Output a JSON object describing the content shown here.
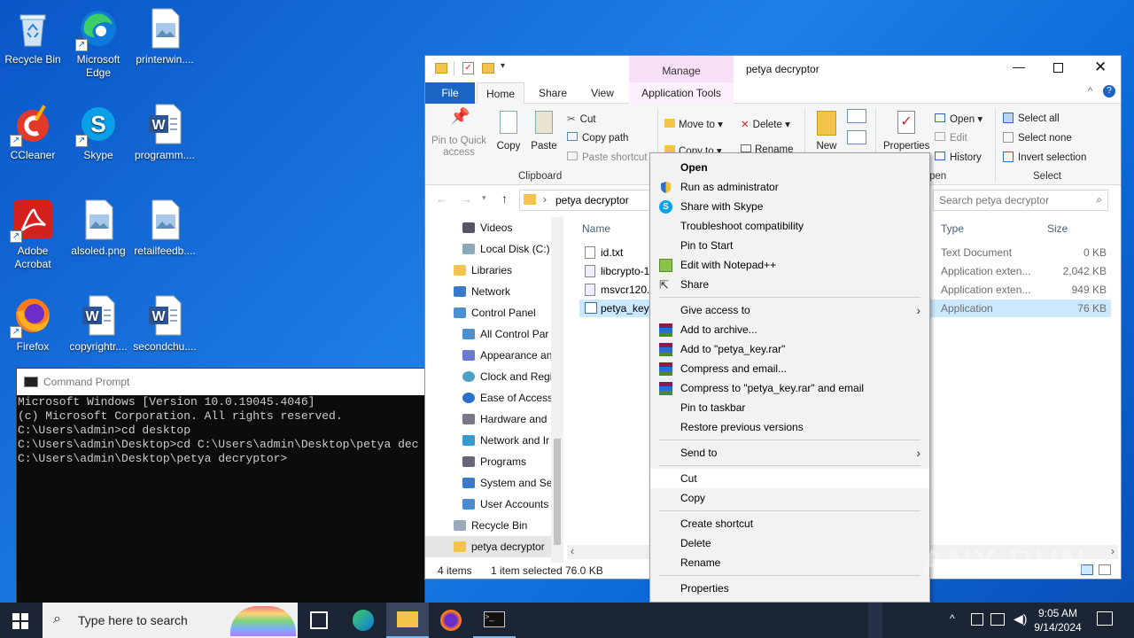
{
  "desktop": {
    "icons": [
      {
        "label": "Recycle Bin",
        "icon": "recycle-bin-icon"
      },
      {
        "label": "Microsoft Edge",
        "icon": "edge-icon"
      },
      {
        "label": "printerwin....",
        "icon": "image-file-icon"
      },
      {
        "label": "CCleaner",
        "icon": "ccleaner-icon"
      },
      {
        "label": "Skype",
        "icon": "skype-icon"
      },
      {
        "label": "programm....",
        "icon": "word-doc-icon"
      },
      {
        "label": "Adobe Acrobat",
        "icon": "acrobat-icon"
      },
      {
        "label": "alsoled.png",
        "icon": "image-file-icon"
      },
      {
        "label": "retailfeedb....",
        "icon": "image-file-icon"
      },
      {
        "label": "Firefox",
        "icon": "firefox-icon"
      },
      {
        "label": "copyrightr....",
        "icon": "word-doc-icon"
      },
      {
        "label": "secondchu....",
        "icon": "word-doc-icon"
      }
    ]
  },
  "explorer": {
    "title": "petya decryptor",
    "manage_label": "Manage",
    "tabs": [
      "File",
      "Home",
      "Share",
      "View",
      "Application Tools"
    ],
    "ribbon": {
      "pin_label": "Pin to Quick access",
      "copy": "Copy",
      "paste": "Paste",
      "cut": "Cut",
      "copy_path": "Copy path",
      "paste_shortcut": "Paste shortcut",
      "clipboard_group": "Clipboard",
      "move_to": "Move to",
      "delete": "Delete",
      "copy_to": "Copy to",
      "rename": "Rename",
      "new": "New",
      "properties": "Properties",
      "open": "Open",
      "edit": "Edit",
      "history": "History",
      "open_group": "pen",
      "select_all": "Select all",
      "select_none": "Select none",
      "invert_selection": "Invert selection",
      "select_group": "Select"
    },
    "address": {
      "crumb": "petya decryptor",
      "search_placeholder": "Search petya decryptor"
    },
    "nav_items": [
      "Videos",
      "Local Disk (C:)",
      "Libraries",
      "Network",
      "Control Panel",
      "All Control Par",
      "Appearance an",
      "Clock and Regi",
      "Ease of Access",
      "Hardware and",
      "Network and Ir",
      "Programs",
      "System and Se",
      "User Accounts",
      "Recycle Bin",
      "petya decryptor"
    ],
    "columns": {
      "name": "Name",
      "type": "Type",
      "size": "Size"
    },
    "files": [
      {
        "name": "id.txt",
        "type": "Text Document",
        "size": "0 KB"
      },
      {
        "name": "libcrypto-1",
        "type": "Application exten...",
        "size": "2,042 KB"
      },
      {
        "name": "msvcr120.d",
        "type": "Application exten...",
        "size": "949 KB"
      },
      {
        "name": "petya_key.",
        "type": "Application",
        "size": "76 KB"
      }
    ],
    "status": {
      "items": "4 items",
      "selected": "1 item selected",
      "size": "76.0 KB"
    }
  },
  "context_menu": {
    "items": [
      "Open",
      "Run as administrator",
      "Share with Skype",
      "Troubleshoot compatibility",
      "Pin to Start",
      "Edit with Notepad++",
      "Share",
      "Give access to",
      "Add to archive...",
      "Add to \"petya_key.rar\"",
      "Compress and email...",
      "Compress to \"petya_key.rar\" and email",
      "Pin to taskbar",
      "Restore previous versions",
      "Send to",
      "Cut",
      "Copy",
      "Create shortcut",
      "Delete",
      "Rename",
      "Properties"
    ]
  },
  "cmd": {
    "title": "Command Prompt",
    "lines": [
      "Microsoft Windows [Version 10.0.19045.4046]",
      "(c) Microsoft Corporation. All rights reserved.",
      "",
      "C:\\Users\\admin>cd desktop",
      "",
      "C:\\Users\\admin\\Desktop>cd C:\\Users\\admin\\Desktop\\petya dec",
      "",
      "C:\\Users\\admin\\Desktop\\petya decryptor>"
    ]
  },
  "taskbar": {
    "search_placeholder": "Type here to search",
    "time": "9:05 AM",
    "date": "9/14/2024"
  },
  "watermark": "ANY RUN",
  "colors": {
    "accent": "#0063b1",
    "selection": "#cce8ff",
    "taskbar": "#1c2536"
  }
}
